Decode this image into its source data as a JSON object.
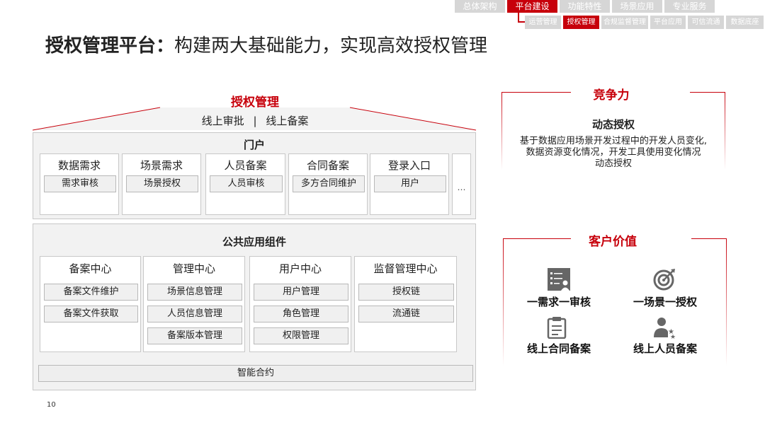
{
  "nav": {
    "primary": [
      {
        "label": "总体架构",
        "active": false
      },
      {
        "label": "平台建设",
        "active": true
      },
      {
        "label": "功能特性",
        "active": false
      },
      {
        "label": "场景应用",
        "active": false
      },
      {
        "label": "专业服务",
        "active": false
      }
    ],
    "secondary": [
      {
        "label": "运营管理",
        "active": false
      },
      {
        "label": "授权管理",
        "active": true
      },
      {
        "label": "合规监督管理",
        "active": false
      },
      {
        "label": "平台应用",
        "active": false
      },
      {
        "label": "可信流通",
        "active": false
      },
      {
        "label": "数据底座",
        "active": false
      }
    ]
  },
  "title": {
    "bold": "授权管理平台：",
    "rest": "构建两大基础能力，实现高效授权管理"
  },
  "left": {
    "heading": "授权管理",
    "sub_a": "线上审批",
    "sub_sep": "|",
    "sub_b": "线上备案",
    "portal": {
      "title": "门户",
      "cards": [
        {
          "title": "数据需求",
          "chip": "需求审核"
        },
        {
          "title": "场景需求",
          "chip": "场景授权"
        },
        {
          "title": "人员备案",
          "chip": "人员审核"
        },
        {
          "title": "合同备案",
          "chip": "多方合同维护"
        },
        {
          "title": "登录入口",
          "chip": "用户"
        }
      ],
      "more": "…"
    },
    "components": {
      "title": "公共应用组件",
      "cards": [
        {
          "title": "备案中心",
          "chips": [
            "备案文件维护",
            "备案文件获取"
          ]
        },
        {
          "title": "管理中心",
          "chips": [
            "场景信息管理",
            "人员信息管理",
            "备案版本管理"
          ]
        },
        {
          "title": "用户中心",
          "chips": [
            "用户管理",
            "角色管理",
            "权限管理"
          ]
        },
        {
          "title": "监督管理中心",
          "chips": [
            "授权链",
            "流通链"
          ]
        }
      ],
      "footer": "智能合约"
    }
  },
  "right": {
    "competitiveness": {
      "heading": "竞争力",
      "subtitle": "动态授权",
      "desc_lines": [
        "基于数据应用场景开发过程中的开发人员变化,",
        "数据资源变化情况，开发工具使用变化情况",
        "动态授权"
      ]
    },
    "customer_value": {
      "heading": "客户价值",
      "items": [
        {
          "label": "一需求一审核",
          "icon": "checklist-person-icon"
        },
        {
          "label": "一场景一授权",
          "icon": "target-icon"
        },
        {
          "label": "线上合同备案",
          "icon": "clipboard-icon"
        },
        {
          "label": "线上人员备案",
          "icon": "person-stars-icon"
        }
      ]
    }
  },
  "page_number": "10",
  "colors": {
    "accent": "#c7000b",
    "tab_inactive": "#d6d6d6",
    "panel_bg": "#f2f2f2"
  }
}
